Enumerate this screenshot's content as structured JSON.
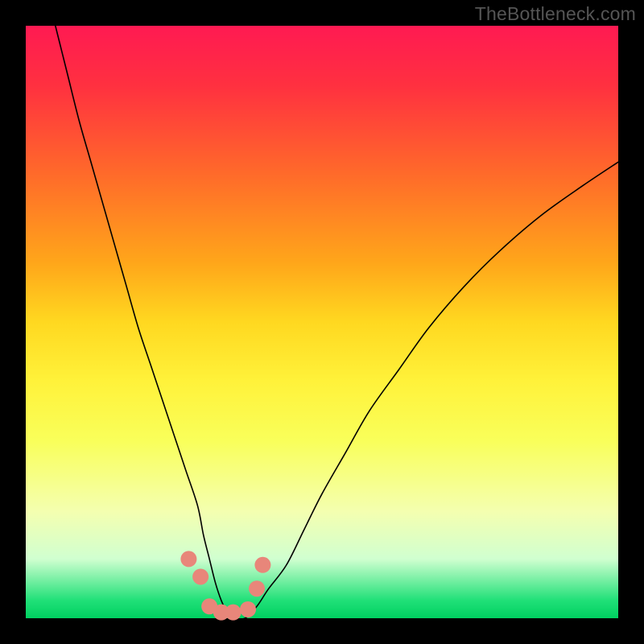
{
  "attribution": "TheBottleneck.com",
  "chart_data": {
    "type": "line",
    "title": "",
    "xlabel": "",
    "ylabel": "",
    "xlim": [
      0,
      100
    ],
    "ylim": [
      0,
      100
    ],
    "series": [
      {
        "name": "curve",
        "x": [
          5,
          7,
          9,
          11,
          13,
          15,
          17,
          19,
          21,
          23,
          25,
          27,
          29,
          30,
          31,
          32,
          33,
          34,
          35,
          37,
          39,
          41,
          44,
          47,
          50,
          54,
          58,
          63,
          68,
          74,
          80,
          87,
          94,
          100
        ],
        "values": [
          100,
          92,
          84,
          77,
          70,
          63,
          56,
          49,
          43,
          37,
          31,
          25,
          19,
          14,
          10,
          6,
          3,
          1,
          0,
          0,
          2,
          5,
          9,
          15,
          21,
          28,
          35,
          42,
          49,
          56,
          62,
          68,
          73,
          77
        ]
      }
    ],
    "markers": {
      "x": [
        27.5,
        29.5,
        31,
        33,
        35,
        37.5,
        39,
        40
      ],
      "values": [
        10,
        7,
        2,
        1,
        1,
        1.5,
        5,
        9
      ]
    },
    "gradient_stops": [
      {
        "pos": 0,
        "color": "#ff1a52"
      },
      {
        "pos": 10,
        "color": "#ff3040"
      },
      {
        "pos": 25,
        "color": "#ff6a2a"
      },
      {
        "pos": 40,
        "color": "#ffa61a"
      },
      {
        "pos": 50,
        "color": "#ffd820"
      },
      {
        "pos": 60,
        "color": "#fff23a"
      },
      {
        "pos": 70,
        "color": "#f9ff5a"
      },
      {
        "pos": 82,
        "color": "#f4ffb0"
      },
      {
        "pos": 90,
        "color": "#d0ffd0"
      },
      {
        "pos": 97,
        "color": "#20e078"
      },
      {
        "pos": 100,
        "color": "#00d060"
      }
    ]
  }
}
